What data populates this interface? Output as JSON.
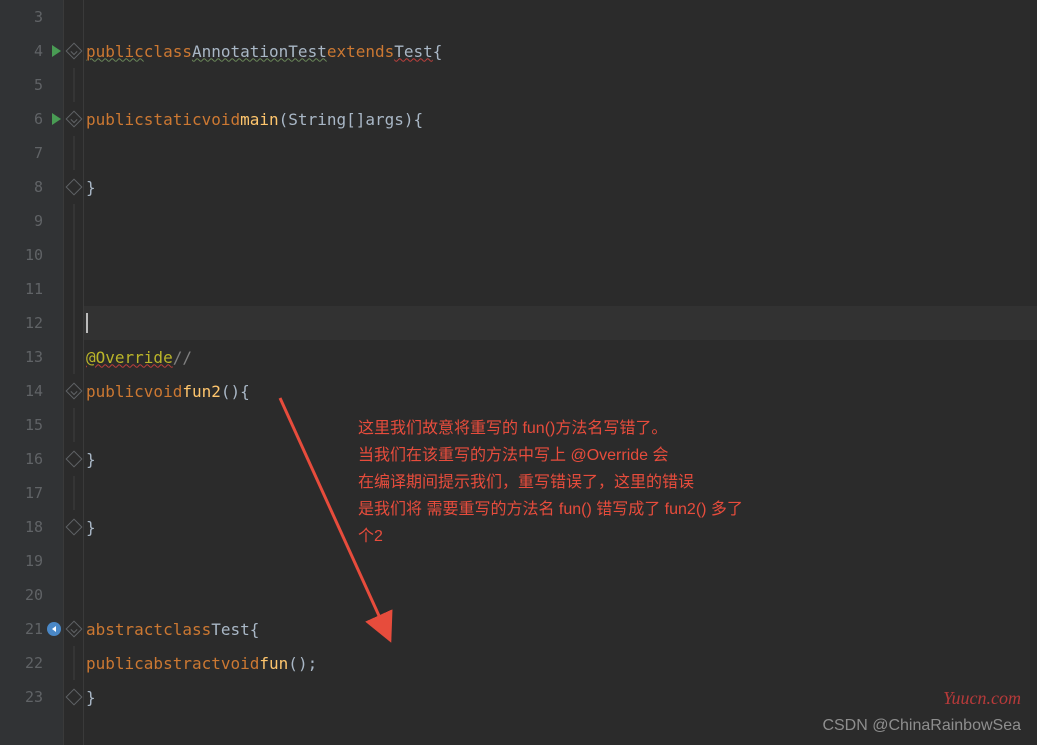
{
  "lines": [
    {
      "num": 3,
      "run": false,
      "fold": null
    },
    {
      "num": 4,
      "run": true,
      "fold": "open"
    },
    {
      "num": 5,
      "run": false,
      "fold": null
    },
    {
      "num": 6,
      "run": true,
      "fold": "open"
    },
    {
      "num": 7,
      "run": false,
      "fold": null
    },
    {
      "num": 8,
      "run": false,
      "fold": "close"
    },
    {
      "num": 9,
      "run": false,
      "fold": null
    },
    {
      "num": 10,
      "run": false,
      "fold": null
    },
    {
      "num": 11,
      "run": false,
      "fold": null
    },
    {
      "num": 12,
      "run": false,
      "fold": null
    },
    {
      "num": 13,
      "run": false,
      "fold": null
    },
    {
      "num": 14,
      "run": false,
      "fold": "open"
    },
    {
      "num": 15,
      "run": false,
      "fold": null
    },
    {
      "num": 16,
      "run": false,
      "fold": "close"
    },
    {
      "num": 17,
      "run": false,
      "fold": null
    },
    {
      "num": 18,
      "run": false,
      "fold": "close"
    },
    {
      "num": 19,
      "run": false,
      "fold": null
    },
    {
      "num": 20,
      "run": false,
      "fold": null
    },
    {
      "num": 21,
      "run": false,
      "fold": "open",
      "override": true,
      "downArrow": true
    },
    {
      "num": 22,
      "run": false,
      "fold": null
    },
    {
      "num": 23,
      "run": false,
      "fold": "close"
    }
  ],
  "tokens": {
    "public": "public",
    "class": "class",
    "className": "AnnotationTest",
    "extends": "extends",
    "superName": "Test",
    "static": "static",
    "void": "void",
    "main": "main",
    "stringArr": "String[]",
    "args": "args",
    "override": "@Override",
    "commentSlash": "//",
    "fun2": "fun2",
    "abstract": "abstract",
    "test": "Test",
    "fun": "fun",
    "lbrace": "{",
    "rbrace": "}",
    "lparen": "(",
    "rparen": ")",
    "semi": ";"
  },
  "annotationLines": [
    "这里我们故意将重写的 fun()方法名写错了。",
    "当我们在该重写的方法中写上 @Override 会",
    "在编译期间提示我们，重写错误了，这里的错误",
    "是我们将 需要重写的方法名 fun() 错写成了 fun2() 多了",
    "个2"
  ],
  "watermark1": "Yuucn.com",
  "watermark2": "CSDN @ChinaRainbowSea"
}
